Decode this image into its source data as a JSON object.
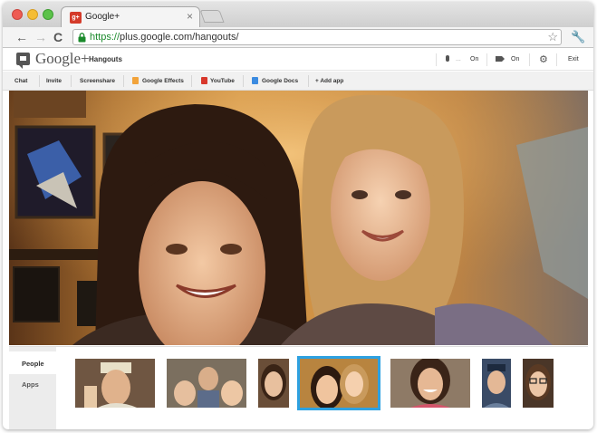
{
  "browser": {
    "tab_title": "Google+",
    "tab_favicon_text": "g+",
    "tab_close": "×",
    "url_scheme": "https://",
    "url_rest": "plus.google.com/hangouts/",
    "back": "←",
    "forward": "→",
    "reload": "C",
    "star": "☆",
    "wrench": "🔧"
  },
  "header": {
    "brand": "Google+",
    "brand_sub": "Hangouts",
    "mic_state": "On",
    "cam_state": "On",
    "exit_label": "Exit",
    "gear": "⚙"
  },
  "app_toolbar": {
    "items": [
      {
        "label": "Chat"
      },
      {
        "label": "Invite"
      },
      {
        "label": "Screenshare"
      },
      {
        "label": "Google Effects"
      },
      {
        "label": "YouTube"
      },
      {
        "label": "Google Docs"
      },
      {
        "label": "+ Add app"
      }
    ]
  },
  "sidebar": {
    "tabs": [
      {
        "label": "People",
        "active": true
      },
      {
        "label": "Apps",
        "active": false
      }
    ]
  },
  "participants": [
    {
      "icon": "participant-man-hat",
      "selected": false
    },
    {
      "icon": "participant-family",
      "selected": false
    },
    {
      "icon": "participant-woman-curly",
      "selected": false
    },
    {
      "icon": "participant-mother-daughter",
      "selected": true
    },
    {
      "icon": "participant-woman-smiling",
      "selected": false
    },
    {
      "icon": "participant-man-cap",
      "selected": false
    },
    {
      "icon": "participant-woman-glasses",
      "selected": false
    }
  ],
  "colors": {
    "selected_border": "#2da1e1",
    "secure_green": "#1b8a2c"
  }
}
